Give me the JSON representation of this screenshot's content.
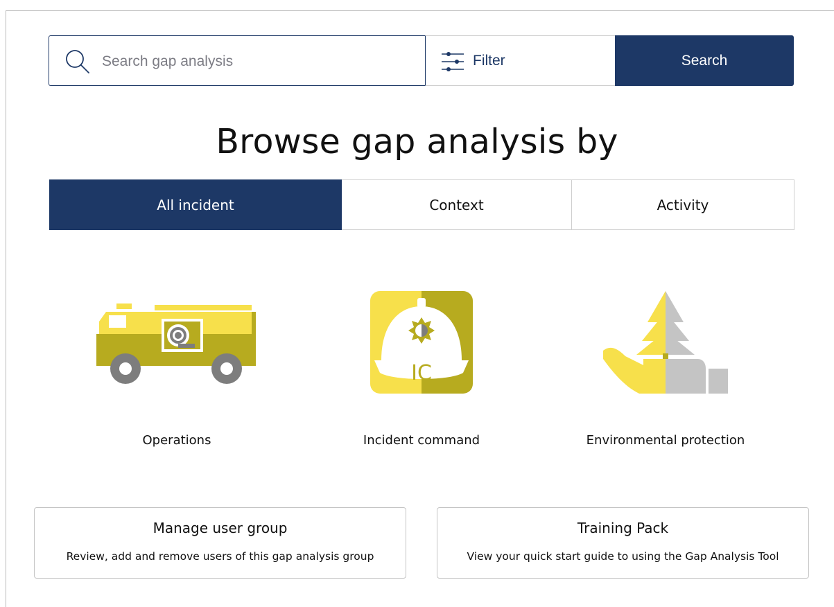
{
  "search": {
    "placeholder": "Search gap analysis",
    "value": "",
    "filter_label": "Filter",
    "button_label": "Search"
  },
  "heading": "Browse gap analysis by",
  "tabs": [
    {
      "label": "All incident",
      "active": true
    },
    {
      "label": "Context",
      "active": false
    },
    {
      "label": "Activity",
      "active": false
    }
  ],
  "categories": [
    {
      "label": "Operations",
      "icon": "fire-truck-icon"
    },
    {
      "label": "Incident command",
      "icon": "incident-command-helmet-icon"
    },
    {
      "label": "Environmental protection",
      "icon": "hand-tree-icon"
    }
  ],
  "cards": [
    {
      "title": "Manage user group",
      "description": "Review, add and remove users of this gap analysis group"
    },
    {
      "title": "Training Pack",
      "description": "View your quick start guide to using the Gap Analysis Tool"
    }
  ],
  "colors": {
    "primary": "#1d3866",
    "icon_yellow": "#f7e04b",
    "icon_olive": "#b7ab1f",
    "icon_grey": "#7d7d7d",
    "icon_lightgrey": "#c4c4c4"
  }
}
